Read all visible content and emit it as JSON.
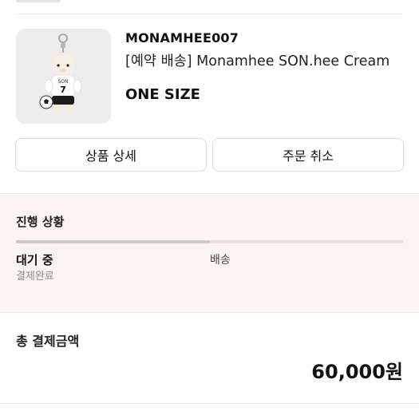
{
  "product": {
    "brand": "MONAMHEE007",
    "name": "[예약 배송] Monamhee SON.hee Cream",
    "option": "ONE SIZE",
    "image_alt": "Monamhee SON.hee Cream bear keychain"
  },
  "actions": {
    "detail_label": "상품 상세",
    "cancel_label": "주문 취소"
  },
  "progress": {
    "title": "진행 상황",
    "current_step": "대기 중",
    "current_sub": "결제완료",
    "next_step": "배송",
    "fraction": 0.5
  },
  "total": {
    "label": "총 결제금액",
    "amount": "60,000원"
  }
}
